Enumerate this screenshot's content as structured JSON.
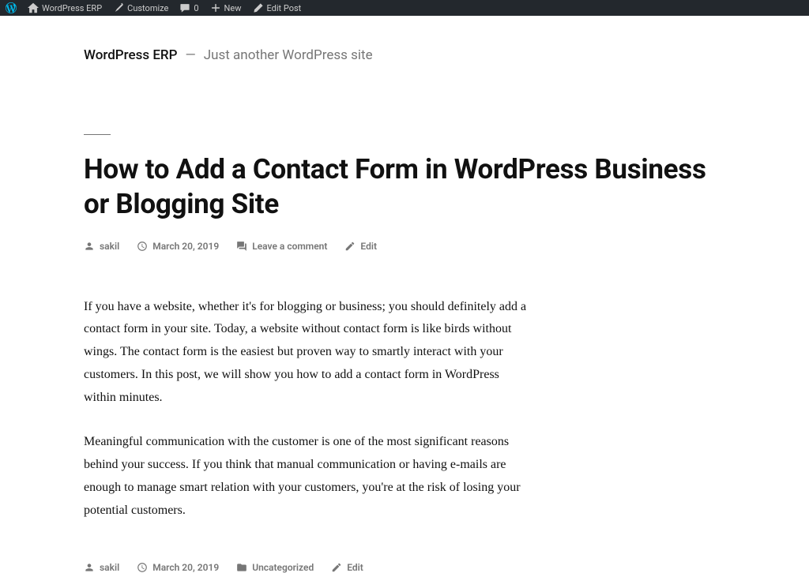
{
  "admin_bar": {
    "site_name": "WordPress ERP",
    "customize": "Customize",
    "comment_count": "0",
    "new": "New",
    "edit_post": "Edit Post"
  },
  "header": {
    "site_title": "WordPress ERP",
    "separator": "—",
    "tagline": "Just another WordPress site"
  },
  "post": {
    "title": "How to Add a Contact Form in WordPress Business or Blogging Site",
    "author": "sakil",
    "date": "March 20, 2019",
    "comment_link": "Leave a comment",
    "edit": "Edit",
    "paragraphs": [
      "If you have a website, whether it's for blogging or business; you should definitely add a contact form in your site. Today, a website without contact form is like birds without wings. The contact form is the easiest but proven way to smartly interact with your customers. In this post, we will show you how to add a contact form in WordPress within minutes.",
      "Meaningful communication with the customer is one of the most significant reasons behind your success. If you think that manual communication or having e-mails are enough to manage smart relation with your customers, you're at the risk of losing your potential customers."
    ],
    "category": "Uncategorized"
  }
}
